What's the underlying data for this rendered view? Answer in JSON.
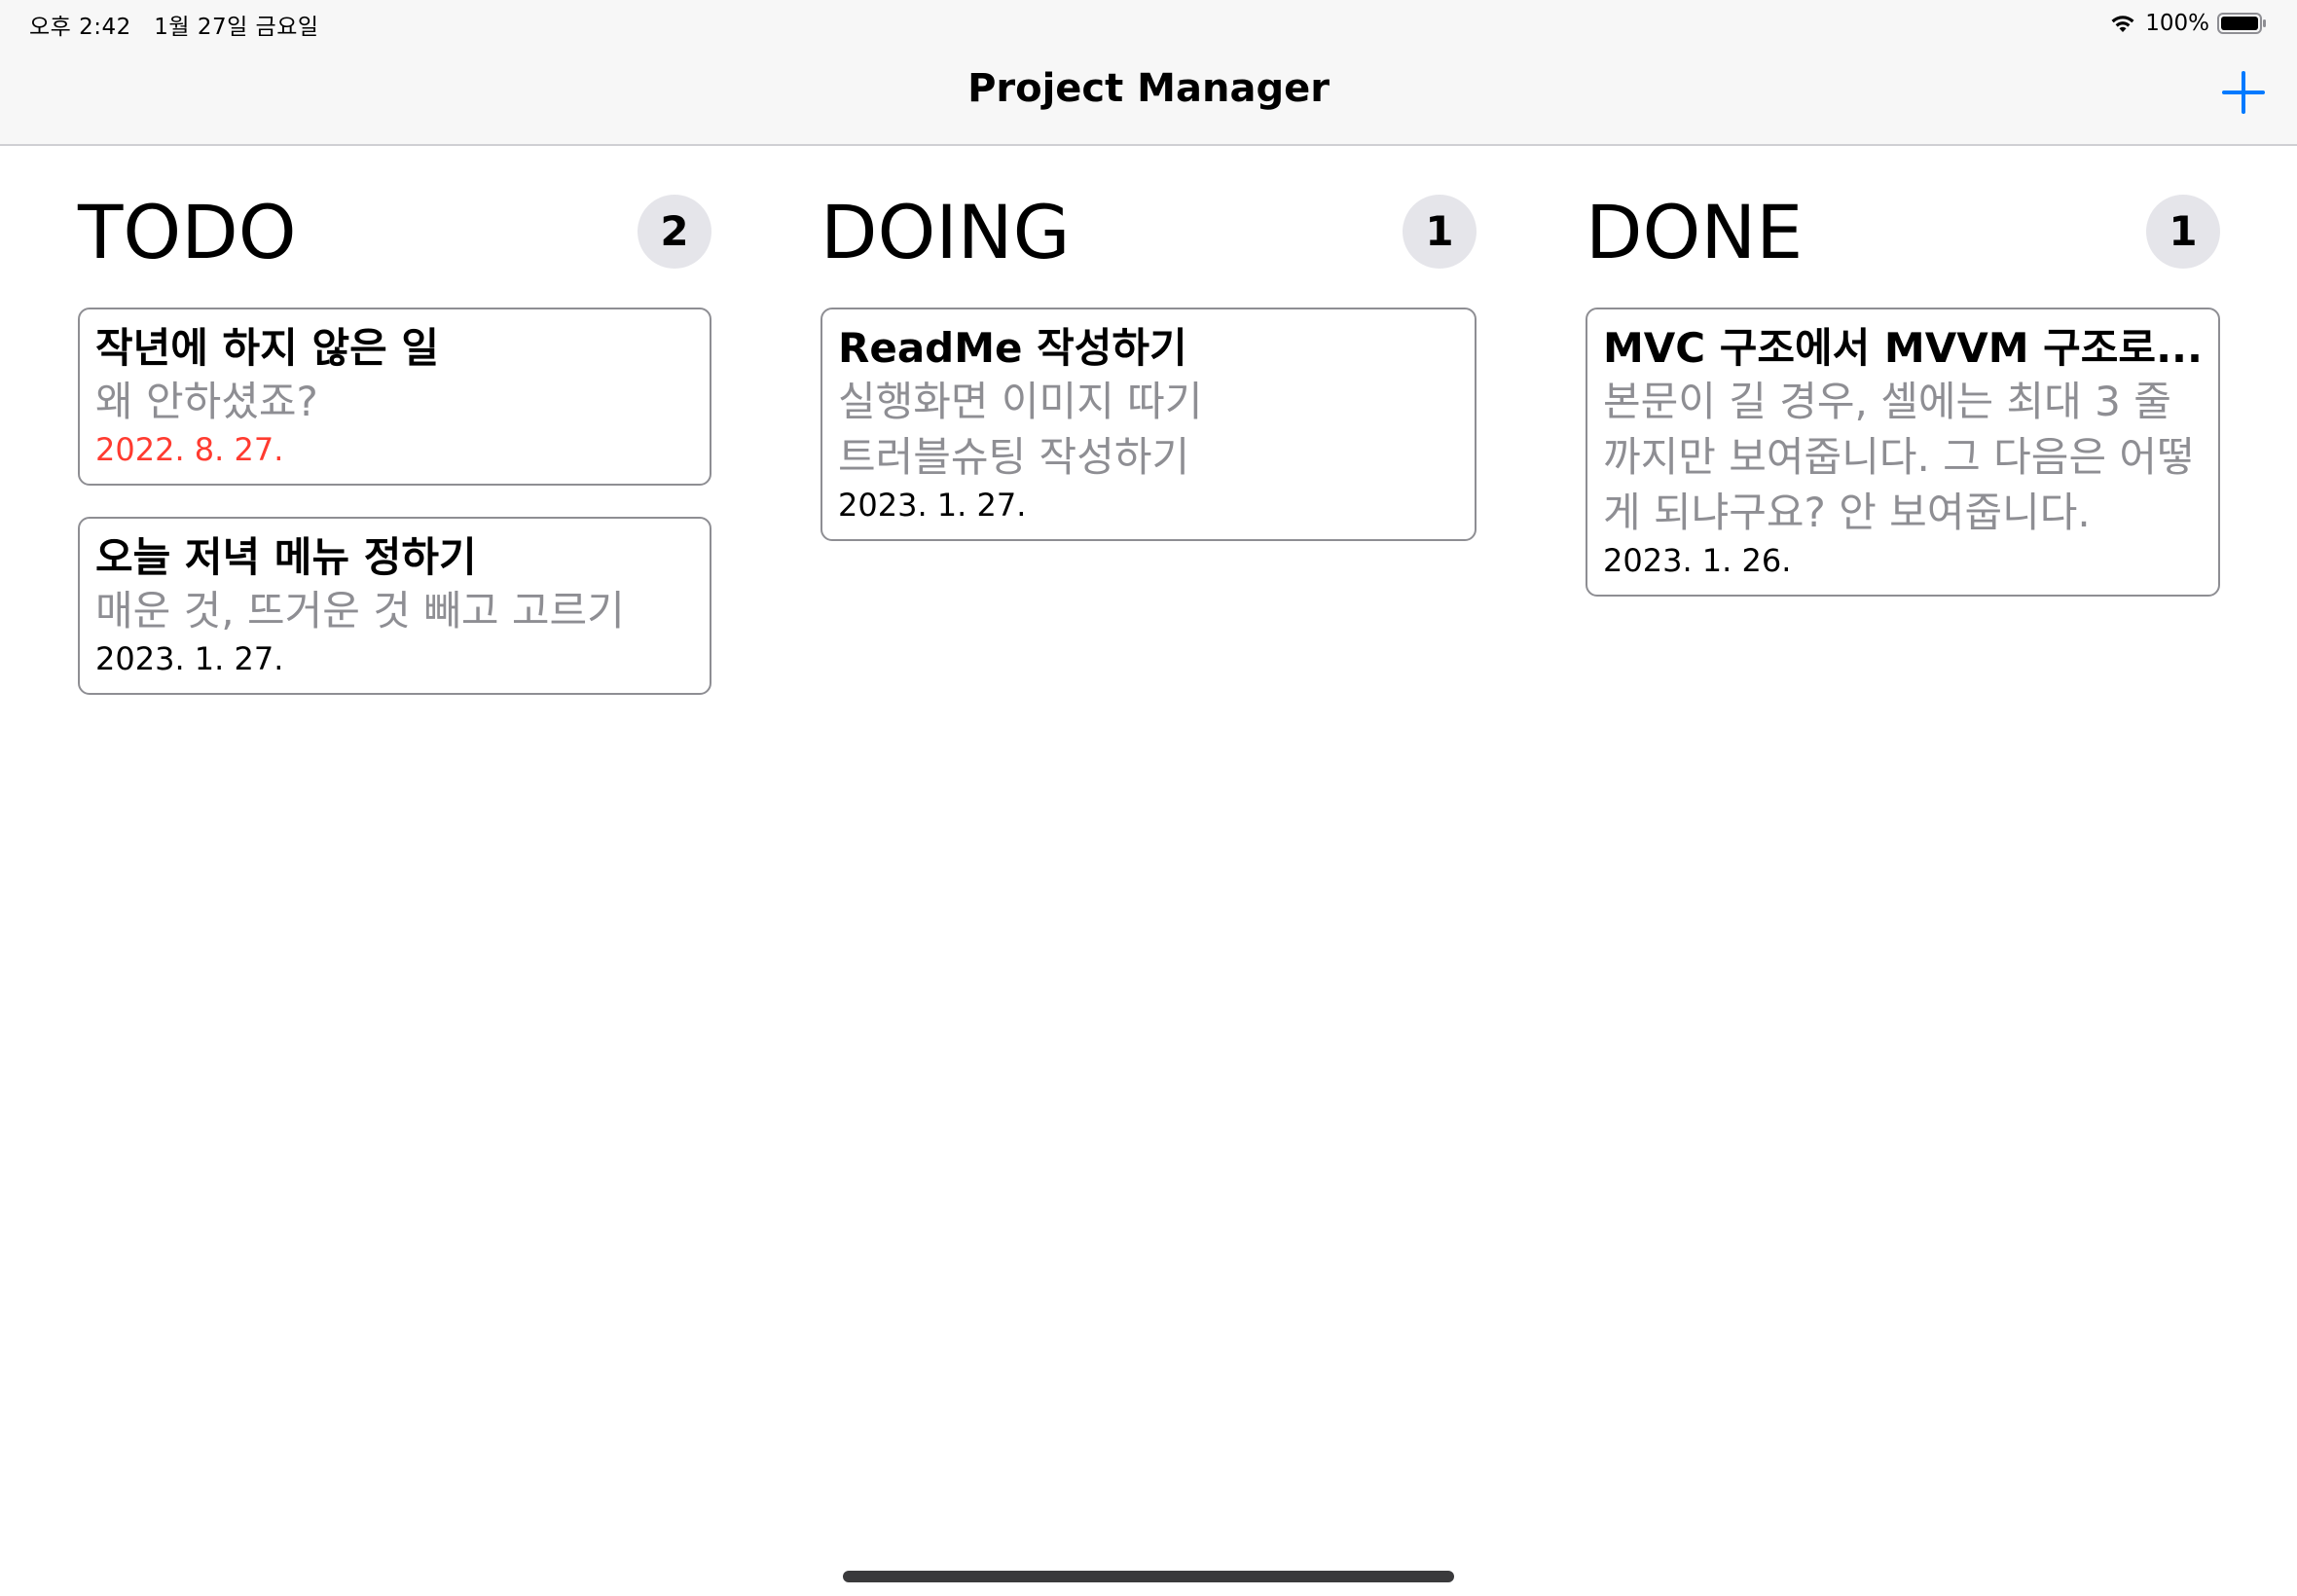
{
  "status_bar": {
    "time": "오후 2:42",
    "date": "1월 27일 금요일",
    "battery": "100%"
  },
  "nav": {
    "title": "Project Manager",
    "add_icon": "plus-icon",
    "accent_color": "#007aff"
  },
  "columns": [
    {
      "title": "TODO",
      "count": "2",
      "cards": [
        {
          "title": "작년에 하지 않은 일",
          "body": "왜 안하셨죠?",
          "date": "2022. 8. 27.",
          "overdue": true
        },
        {
          "title": "오늘 저녁 메뉴 정하기",
          "body": "매운 것, 뜨거운 것 빼고 고르기",
          "date": "2023. 1. 27.",
          "overdue": false
        }
      ]
    },
    {
      "title": "DOING",
      "count": "1",
      "cards": [
        {
          "title": "ReadMe 작성하기",
          "body": "실행화면 이미지 따기\n트러블슈팅 작성하기",
          "date": "2023. 1. 27.",
          "overdue": false
        }
      ]
    },
    {
      "title": "DONE",
      "count": "1",
      "cards": [
        {
          "title": "MVC 구조에서 MVVM 구조로...",
          "body": "본문이 길 경우, 셀에는 최대 3 줄까지만 보여줍니다. 그 다음은 어떻게 되냐구요? 안 보여줍니다.",
          "date": "2023. 1. 26.",
          "overdue": false
        }
      ]
    }
  ],
  "colors": {
    "overdue": "#ff3b30",
    "secondary_text": "#8e8e93",
    "badge_bg": "#e5e5ea"
  }
}
